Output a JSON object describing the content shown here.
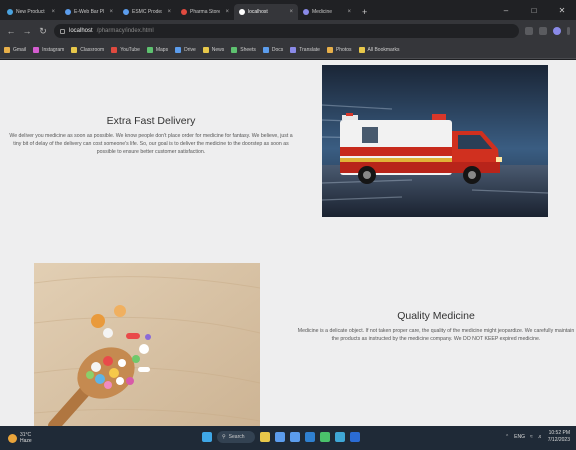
{
  "browser": {
    "tabs": [
      {
        "label": "New Product",
        "color": "#4aa3df"
      },
      {
        "label": "E-Web Bar Pharma",
        "color": "#5c9ded"
      },
      {
        "label": "ESMC Prodesk",
        "color": "#5c9ded"
      },
      {
        "label": "Pharma Store",
        "color": "#e04a3f"
      },
      {
        "label": "localhost",
        "color": "#ffffff"
      },
      {
        "label": "Medicine",
        "color": "#8a8ae8"
      }
    ],
    "new_tab_label": "+",
    "url": "localhost",
    "url_rest": "/pharmacy/index.html",
    "bookmarks": [
      {
        "label": "Gmail",
        "color": "#e8b04a"
      },
      {
        "label": "Instagram",
        "color": "#d45dd0"
      },
      {
        "label": "Classroom",
        "color": "#e8c84a"
      },
      {
        "label": "YouTube",
        "color": "#e04a3f"
      },
      {
        "label": "Maps",
        "color": "#5ec270"
      },
      {
        "label": "Drive",
        "color": "#5c9ded"
      },
      {
        "label": "News",
        "color": "#e8c84a"
      },
      {
        "label": "Sheets",
        "color": "#5ec270"
      },
      {
        "label": "Docs",
        "color": "#5c9ded"
      },
      {
        "label": "Translate",
        "color": "#8a8ae8"
      },
      {
        "label": "Photos",
        "color": "#e8b04a"
      },
      {
        "label": "All Bookmarks",
        "color": "#e8c84a"
      }
    ]
  },
  "section1": {
    "title": "Extra Fast Delivery",
    "body": "We deliver you medicine as soon as possible. We know people don't place order for medicine for fantasy. We believe, just a tiny bit of delay of the delivery can cost someone's life. So, our goal is to deliver the medicine to the doorstep as soon as possible to ensure better customer satisfaction."
  },
  "section2": {
    "title": "Quality Medicine",
    "body": "Medicine is a delicate object. If not taken proper care, the quality of the medicine might jeopardize. We carefully maintain the products as instructed by the medicine company. We DO NOT KEEP expired medicine."
  },
  "taskbar": {
    "weather_temp": "31°C",
    "weather_desc": "Haze",
    "search_label": "Search",
    "time": "10:52 PM",
    "date": "7/12/2023",
    "lang": "ENG",
    "apps": [
      {
        "name": "file-explorer-icon",
        "color": "#e8c84a"
      },
      {
        "name": "chrome-icon",
        "color": "#5c9ded"
      },
      {
        "name": "store-icon",
        "color": "#5c9ded"
      },
      {
        "name": "vscode-icon",
        "color": "#2f80d0"
      },
      {
        "name": "whatsapp-icon",
        "color": "#4ac26b"
      },
      {
        "name": "edge-icon",
        "color": "#3fa7d6"
      },
      {
        "name": "word-icon",
        "color": "#2b6cd4"
      }
    ]
  }
}
